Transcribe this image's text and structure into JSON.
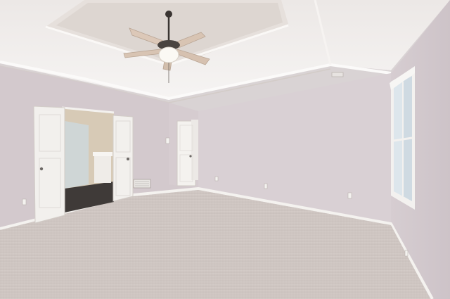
{
  "scene": {
    "subject": "empty-bedroom",
    "features": [
      "tray-ceiling",
      "ceiling-fan",
      "double-doors-to-bathroom",
      "closet-door",
      "window",
      "carpet-floor"
    ]
  },
  "colors": {
    "wall": "#d8cfd3",
    "wall_shadow": "#c9c0c5",
    "ceiling": "#f1efee",
    "ceiling_tray": "#e9e3df",
    "trim": "#f6f4f2",
    "carpet": "#cfc7c3",
    "door": "#f3f1ee",
    "bath_floor": "#3e3a38",
    "bath_wall": "#d9cdb9",
    "window_glass": "#dfe8ee"
  }
}
